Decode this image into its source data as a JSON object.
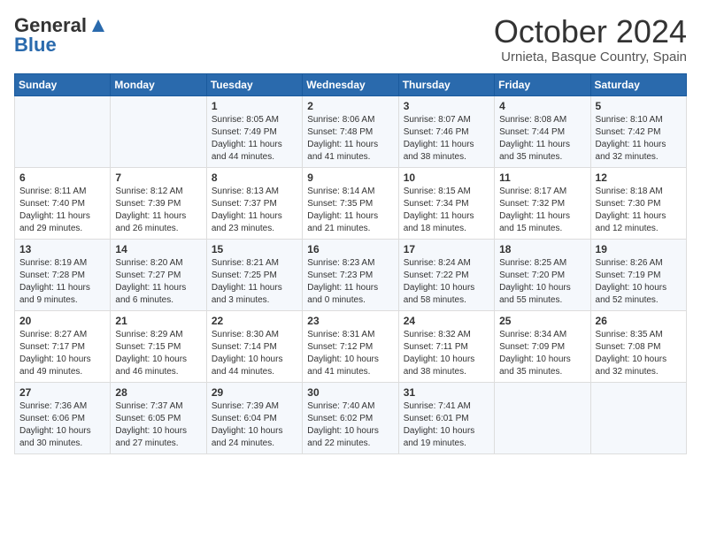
{
  "logo": {
    "general": "General",
    "blue": "Blue",
    "tagline": ""
  },
  "header": {
    "month": "October 2024",
    "location": "Urnieta, Basque Country, Spain"
  },
  "weekdays": [
    "Sunday",
    "Monday",
    "Tuesday",
    "Wednesday",
    "Thursday",
    "Friday",
    "Saturday"
  ],
  "weeks": [
    [
      {
        "day": "",
        "sunrise": "",
        "sunset": "",
        "daylight": ""
      },
      {
        "day": "",
        "sunrise": "",
        "sunset": "",
        "daylight": ""
      },
      {
        "day": "1",
        "sunrise": "Sunrise: 8:05 AM",
        "sunset": "Sunset: 7:49 PM",
        "daylight": "Daylight: 11 hours and 44 minutes."
      },
      {
        "day": "2",
        "sunrise": "Sunrise: 8:06 AM",
        "sunset": "Sunset: 7:48 PM",
        "daylight": "Daylight: 11 hours and 41 minutes."
      },
      {
        "day": "3",
        "sunrise": "Sunrise: 8:07 AM",
        "sunset": "Sunset: 7:46 PM",
        "daylight": "Daylight: 11 hours and 38 minutes."
      },
      {
        "day": "4",
        "sunrise": "Sunrise: 8:08 AM",
        "sunset": "Sunset: 7:44 PM",
        "daylight": "Daylight: 11 hours and 35 minutes."
      },
      {
        "day": "5",
        "sunrise": "Sunrise: 8:10 AM",
        "sunset": "Sunset: 7:42 PM",
        "daylight": "Daylight: 11 hours and 32 minutes."
      }
    ],
    [
      {
        "day": "6",
        "sunrise": "Sunrise: 8:11 AM",
        "sunset": "Sunset: 7:40 PM",
        "daylight": "Daylight: 11 hours and 29 minutes."
      },
      {
        "day": "7",
        "sunrise": "Sunrise: 8:12 AM",
        "sunset": "Sunset: 7:39 PM",
        "daylight": "Daylight: 11 hours and 26 minutes."
      },
      {
        "day": "8",
        "sunrise": "Sunrise: 8:13 AM",
        "sunset": "Sunset: 7:37 PM",
        "daylight": "Daylight: 11 hours and 23 minutes."
      },
      {
        "day": "9",
        "sunrise": "Sunrise: 8:14 AM",
        "sunset": "Sunset: 7:35 PM",
        "daylight": "Daylight: 11 hours and 21 minutes."
      },
      {
        "day": "10",
        "sunrise": "Sunrise: 8:15 AM",
        "sunset": "Sunset: 7:34 PM",
        "daylight": "Daylight: 11 hours and 18 minutes."
      },
      {
        "day": "11",
        "sunrise": "Sunrise: 8:17 AM",
        "sunset": "Sunset: 7:32 PM",
        "daylight": "Daylight: 11 hours and 15 minutes."
      },
      {
        "day": "12",
        "sunrise": "Sunrise: 8:18 AM",
        "sunset": "Sunset: 7:30 PM",
        "daylight": "Daylight: 11 hours and 12 minutes."
      }
    ],
    [
      {
        "day": "13",
        "sunrise": "Sunrise: 8:19 AM",
        "sunset": "Sunset: 7:28 PM",
        "daylight": "Daylight: 11 hours and 9 minutes."
      },
      {
        "day": "14",
        "sunrise": "Sunrise: 8:20 AM",
        "sunset": "Sunset: 7:27 PM",
        "daylight": "Daylight: 11 hours and 6 minutes."
      },
      {
        "day": "15",
        "sunrise": "Sunrise: 8:21 AM",
        "sunset": "Sunset: 7:25 PM",
        "daylight": "Daylight: 11 hours and 3 minutes."
      },
      {
        "day": "16",
        "sunrise": "Sunrise: 8:23 AM",
        "sunset": "Sunset: 7:23 PM",
        "daylight": "Daylight: 11 hours and 0 minutes."
      },
      {
        "day": "17",
        "sunrise": "Sunrise: 8:24 AM",
        "sunset": "Sunset: 7:22 PM",
        "daylight": "Daylight: 10 hours and 58 minutes."
      },
      {
        "day": "18",
        "sunrise": "Sunrise: 8:25 AM",
        "sunset": "Sunset: 7:20 PM",
        "daylight": "Daylight: 10 hours and 55 minutes."
      },
      {
        "day": "19",
        "sunrise": "Sunrise: 8:26 AM",
        "sunset": "Sunset: 7:19 PM",
        "daylight": "Daylight: 10 hours and 52 minutes."
      }
    ],
    [
      {
        "day": "20",
        "sunrise": "Sunrise: 8:27 AM",
        "sunset": "Sunset: 7:17 PM",
        "daylight": "Daylight: 10 hours and 49 minutes."
      },
      {
        "day": "21",
        "sunrise": "Sunrise: 8:29 AM",
        "sunset": "Sunset: 7:15 PM",
        "daylight": "Daylight: 10 hours and 46 minutes."
      },
      {
        "day": "22",
        "sunrise": "Sunrise: 8:30 AM",
        "sunset": "Sunset: 7:14 PM",
        "daylight": "Daylight: 10 hours and 44 minutes."
      },
      {
        "day": "23",
        "sunrise": "Sunrise: 8:31 AM",
        "sunset": "Sunset: 7:12 PM",
        "daylight": "Daylight: 10 hours and 41 minutes."
      },
      {
        "day": "24",
        "sunrise": "Sunrise: 8:32 AM",
        "sunset": "Sunset: 7:11 PM",
        "daylight": "Daylight: 10 hours and 38 minutes."
      },
      {
        "day": "25",
        "sunrise": "Sunrise: 8:34 AM",
        "sunset": "Sunset: 7:09 PM",
        "daylight": "Daylight: 10 hours and 35 minutes."
      },
      {
        "day": "26",
        "sunrise": "Sunrise: 8:35 AM",
        "sunset": "Sunset: 7:08 PM",
        "daylight": "Daylight: 10 hours and 32 minutes."
      }
    ],
    [
      {
        "day": "27",
        "sunrise": "Sunrise: 7:36 AM",
        "sunset": "Sunset: 6:06 PM",
        "daylight": "Daylight: 10 hours and 30 minutes."
      },
      {
        "day": "28",
        "sunrise": "Sunrise: 7:37 AM",
        "sunset": "Sunset: 6:05 PM",
        "daylight": "Daylight: 10 hours and 27 minutes."
      },
      {
        "day": "29",
        "sunrise": "Sunrise: 7:39 AM",
        "sunset": "Sunset: 6:04 PM",
        "daylight": "Daylight: 10 hours and 24 minutes."
      },
      {
        "day": "30",
        "sunrise": "Sunrise: 7:40 AM",
        "sunset": "Sunset: 6:02 PM",
        "daylight": "Daylight: 10 hours and 22 minutes."
      },
      {
        "day": "31",
        "sunrise": "Sunrise: 7:41 AM",
        "sunset": "Sunset: 6:01 PM",
        "daylight": "Daylight: 10 hours and 19 minutes."
      },
      {
        "day": "",
        "sunrise": "",
        "sunset": "",
        "daylight": ""
      },
      {
        "day": "",
        "sunrise": "",
        "sunset": "",
        "daylight": ""
      }
    ]
  ]
}
